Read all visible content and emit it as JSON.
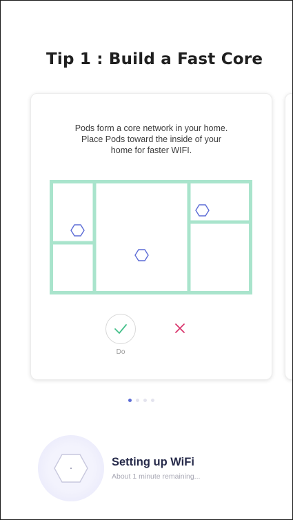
{
  "tip": {
    "title": "Tip 1 : Build a Fast Core",
    "description_lines": [
      "Pods form a core network in your home.",
      "Place Pods toward the inside of your",
      "home for faster WIFI."
    ],
    "do_label": "Do"
  },
  "pagination": {
    "count": 4,
    "active_index": 0
  },
  "status": {
    "title": "Setting up WiFi",
    "subtitle": "About 1 minute remaining..."
  },
  "colors": {
    "floorplan_green": "#a9e4cc",
    "pod_outline": "#5b6bd6",
    "check_green": "#44c08a",
    "cross_pink": "#d8326a",
    "dot_active": "#5b6bd6",
    "dot_inactive": "#e3e3ee"
  },
  "icons": [
    "pod-hexagon-icon",
    "checkmark-icon",
    "cross-icon"
  ]
}
